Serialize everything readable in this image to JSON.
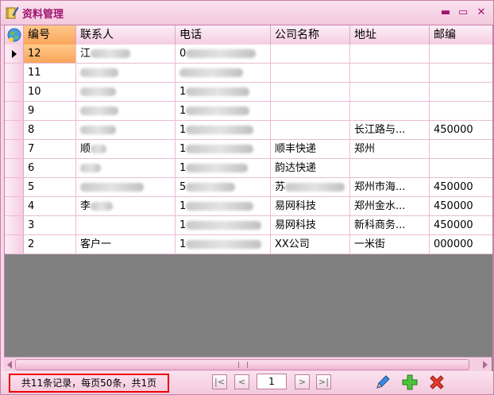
{
  "window": {
    "title": "资料管理"
  },
  "grid": {
    "columns": [
      "编号",
      "联系人",
      "电话",
      "公司名称",
      "地址",
      "邮编"
    ],
    "rows": [
      {
        "id": "12",
        "contact": "江",
        "phone": "0",
        "company": "",
        "address": "",
        "zip": ""
      },
      {
        "id": "11",
        "contact": "",
        "phone": "",
        "company": "",
        "address": "",
        "zip": ""
      },
      {
        "id": "10",
        "contact": "",
        "phone": "1",
        "company": "",
        "address": "",
        "zip": ""
      },
      {
        "id": "9",
        "contact": "",
        "phone": "1",
        "company": "",
        "address": "",
        "zip": ""
      },
      {
        "id": "8",
        "contact": "",
        "phone": "1",
        "company": "",
        "address": "长江路与...",
        "zip": "450000"
      },
      {
        "id": "7",
        "contact": "顺",
        "phone": "1",
        "company": "顺丰快递",
        "address": "郑州",
        "zip": ""
      },
      {
        "id": "6",
        "contact": "",
        "phone": "1",
        "company": "韵达快递",
        "address": "",
        "zip": ""
      },
      {
        "id": "5",
        "contact": "",
        "phone": "5",
        "company": "苏",
        "address": "郑州市海...",
        "zip": "450000"
      },
      {
        "id": "4",
        "contact": "李",
        "phone": "1",
        "company": "易网科技",
        "address": "郑州金水...",
        "zip": "450000"
      },
      {
        "id": "3",
        "contact": "",
        "phone": "1",
        "company": "易网科技",
        "address": "新科商务...",
        "zip": "450000"
      },
      {
        "id": "2",
        "contact": "客户一",
        "phone": "1",
        "company": "XX公司",
        "address": "一米街",
        "zip": "000000"
      }
    ]
  },
  "status": {
    "summary": "共11条记录，每页50条，共1页",
    "page": "1"
  }
}
